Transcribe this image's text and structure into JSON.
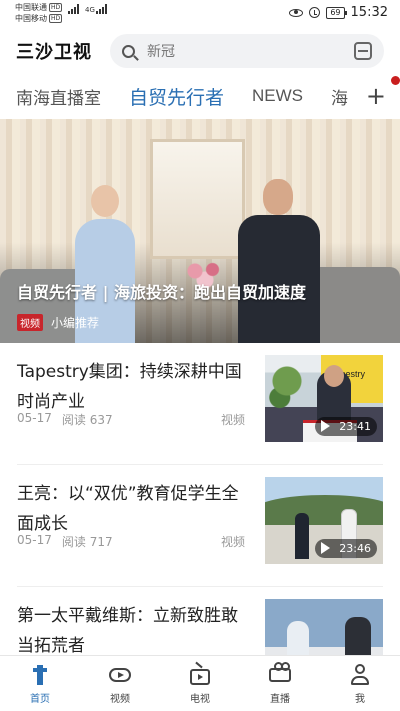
{
  "status_bar": {
    "carrier1": "中国联通",
    "carrier2": "中国移动",
    "hd": "HD",
    "net": "4G",
    "battery": "69",
    "time": "15:32"
  },
  "header": {
    "brand": "三沙卫视",
    "search_placeholder": "新冠"
  },
  "tabs": [
    {
      "label": "南海直播室"
    },
    {
      "label": "自贸先行者"
    },
    {
      "label": "NEWS"
    },
    {
      "label": "海"
    }
  ],
  "hero": {
    "title": "自贸先行者 | 海旅投资：跑出自贸加速度",
    "badge": "视频",
    "tag": "小编推荐"
  },
  "articles": [
    {
      "title": "Tapestry集团：持续深耕中国时尚产业",
      "date": "05-17",
      "reads": "阅读 637",
      "kind": "视频",
      "duration": "23:41",
      "thumb_text": "tapestry"
    },
    {
      "title": "王亮：以“双优”教育促学生全面成长",
      "date": "05-17",
      "reads": "阅读 717",
      "kind": "视频",
      "duration": "23:46"
    },
    {
      "title": "第一太平戴维斯：立新致胜敢当拓荒者",
      "date": "",
      "reads": "",
      "kind": "",
      "duration": ""
    }
  ],
  "bottom_nav": [
    {
      "label": "首页",
      "icon": "home-icon"
    },
    {
      "label": "视频",
      "icon": "video-icon"
    },
    {
      "label": "电视",
      "icon": "tv-icon"
    },
    {
      "label": "直播",
      "icon": "live-icon"
    },
    {
      "label": "我",
      "icon": "profile-icon"
    }
  ],
  "colors": {
    "accent": "#2a6fb3",
    "badge": "#c8252b"
  }
}
